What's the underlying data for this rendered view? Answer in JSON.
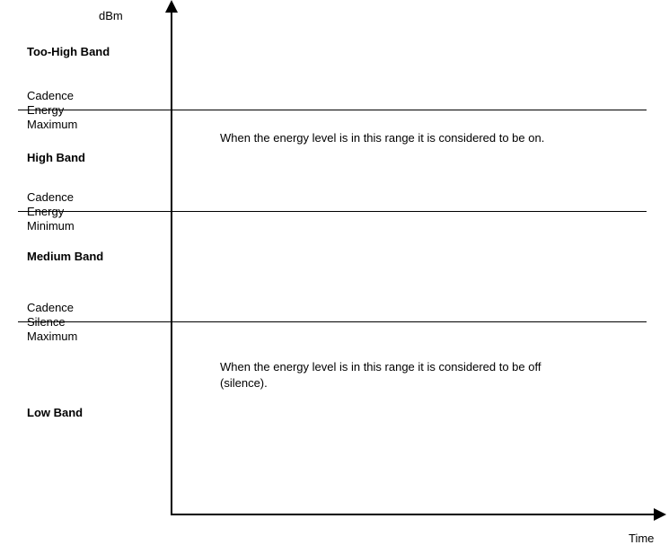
{
  "chart_data": {
    "type": "diagram",
    "y_axis_label": "dBm",
    "x_axis_label": "Time",
    "bands": [
      {
        "id": "too-high",
        "label": "Too-High Band"
      },
      {
        "id": "high",
        "label": "High Band"
      },
      {
        "id": "medium",
        "label": "Medium Band"
      },
      {
        "id": "low",
        "label": "Low Band"
      }
    ],
    "thresholds": [
      {
        "id": "energy-max",
        "label": "Cadence\nEnergy\nMaximum"
      },
      {
        "id": "energy-min",
        "label": "Cadence\nEnergy\nMinimum"
      },
      {
        "id": "silence-max",
        "label": "Cadence\nSilence\nMaximum"
      }
    ],
    "annotations": [
      {
        "id": "on-range",
        "text": "When the energy level is in this range it is considered to be on."
      },
      {
        "id": "off-range",
        "text": "When the energy level is in this range it is considered to be off (silence)."
      }
    ]
  }
}
